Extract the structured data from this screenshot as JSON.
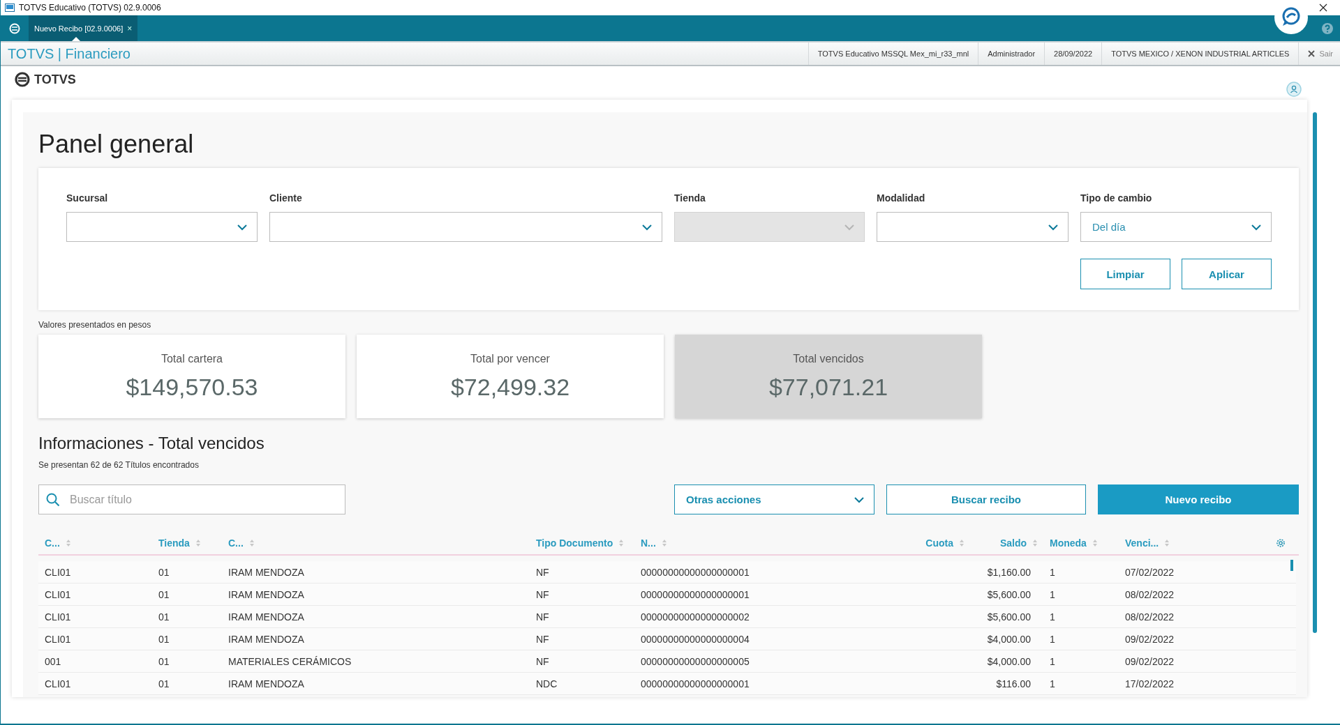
{
  "window": {
    "title": "TOTVS Educativo (TOTVS) 02.9.0006"
  },
  "tabs": [
    {
      "label": "Nuevo Recibo [02.9.0006]",
      "selected": true,
      "close": "×"
    }
  ],
  "header": {
    "module": "TOTVS | Financiero",
    "info": [
      "TOTVS Educativo MSSQL Mex_mi_r33_mnl",
      "Administrador",
      "28/09/2022",
      "TOTVS MEXICO / XENON INDUSTRIAL ARTICLES"
    ],
    "exit": "Sair"
  },
  "logo": {
    "text": "TOTVS"
  },
  "page": {
    "title": "Panel general"
  },
  "filters": [
    {
      "label": "Sucursal",
      "disabled": false
    },
    {
      "label": "Cliente",
      "disabled": false
    },
    {
      "label": "Tienda",
      "disabled": true
    },
    {
      "label": "Modalidad",
      "disabled": false
    },
    {
      "label": "Tipo de cambio",
      "disabled": false,
      "value": "Del día"
    }
  ],
  "filter_buttons": [
    "Limpiar",
    "Aplicar"
  ],
  "note": "Valores presentados en pesos",
  "totals": [
    {
      "label": "Total cartera",
      "amount": "$149,570.53",
      "selected": false
    },
    {
      "label": "Total por vencer",
      "amount": "$72,499.32",
      "selected": false
    },
    {
      "label": "Total vencidos",
      "amount": "$77,071.21",
      "selected": true
    }
  ],
  "section": {
    "title": "Informaciones - Total vencidos",
    "subtitle": "Se presentan 62 de 62 Títulos encontrados"
  },
  "search": {
    "placeholder": "Buscar título"
  },
  "actions": [
    {
      "label": "Otras acciones",
      "kind": "dropdown"
    },
    {
      "label": "Buscar recibo",
      "kind": "secondary"
    },
    {
      "label": "Nuevo recibo",
      "kind": "primary"
    }
  ],
  "table": {
    "columns": [
      {
        "label": "C...",
        "kind": "text"
      },
      {
        "label": "Tienda",
        "kind": "text"
      },
      {
        "label": "C...",
        "kind": "text"
      },
      {
        "label": "Tipo Documento",
        "kind": "text"
      },
      {
        "label": "N...",
        "kind": "text"
      },
      {
        "label": "Cuota",
        "kind": "number"
      },
      {
        "label": "Saldo",
        "kind": "number"
      },
      {
        "label": "Moneda",
        "kind": "text"
      },
      {
        "label": "Venci...",
        "kind": "text"
      }
    ],
    "rows": [
      [
        "CLI01",
        "01",
        "IRAM MENDOZA",
        "NF",
        "00000000000000000001",
        "",
        "$1,160.00",
        "1",
        "07/02/2022"
      ],
      [
        "CLI01",
        "01",
        "IRAM MENDOZA",
        "NF",
        "00000000000000000001",
        "",
        "$5,600.00",
        "1",
        "08/02/2022"
      ],
      [
        "CLI01",
        "01",
        "IRAM MENDOZA",
        "NF",
        "00000000000000000002",
        "",
        "$5,600.00",
        "1",
        "08/02/2022"
      ],
      [
        "CLI01",
        "01",
        "IRAM MENDOZA",
        "NF",
        "00000000000000000004",
        "",
        "$4,000.00",
        "1",
        "09/02/2022"
      ],
      [
        "001",
        "01",
        "MATERIALES CERÁMICOS",
        "NF",
        "00000000000000000005",
        "",
        "$4,000.00",
        "1",
        "09/02/2022"
      ],
      [
        "CLI01",
        "01",
        "IRAM MENDOZA",
        "NDC",
        "00000000000000000001",
        "",
        "$116.00",
        "1",
        "17/02/2022"
      ]
    ]
  }
}
